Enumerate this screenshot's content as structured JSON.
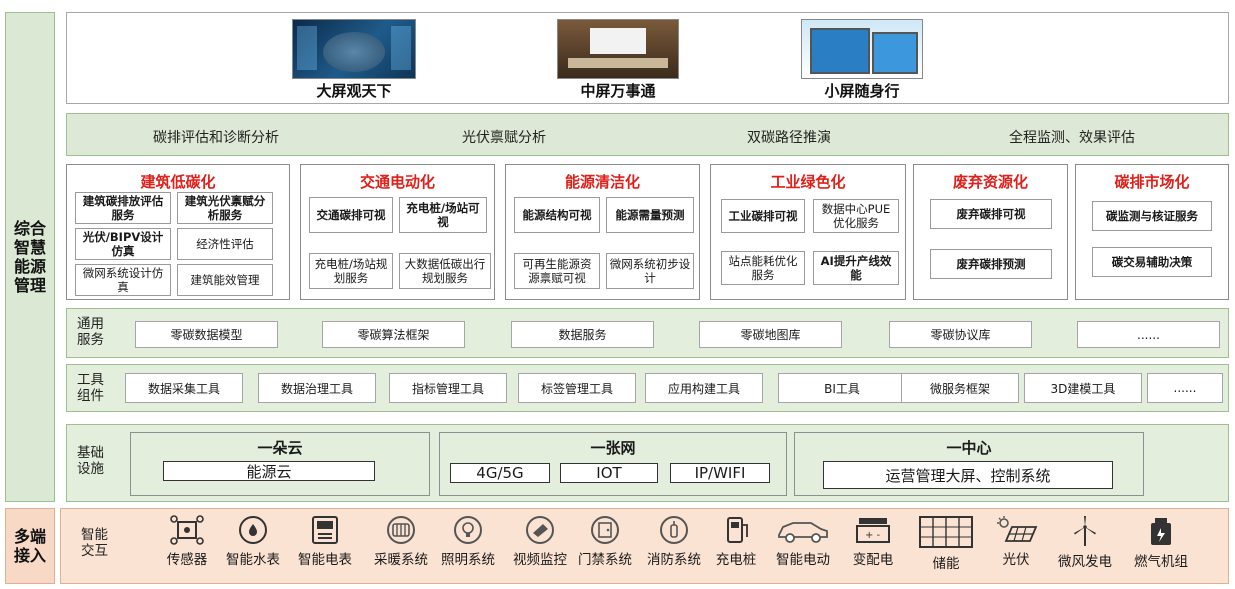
{
  "sidebar": {
    "top": "综合智慧能源管理",
    "bottom": "多端接入"
  },
  "screens": [
    {
      "label": "大屏观天下"
    },
    {
      "label": "中屏万事通"
    },
    {
      "label": "小屏随身行"
    }
  ],
  "analysis": [
    "碳排评估和诊断分析",
    "光伏禀赋分析",
    "双碳路径推演",
    "全程监测、效果评估"
  ],
  "categories": [
    {
      "title": "建筑低碳化",
      "items": [
        "建筑碳排放评估服务",
        "建筑光伏禀赋分析服务",
        "光伏/BIPV设计仿真",
        "经济性评估",
        "微网系统设计仿真",
        "建筑能效管理"
      ]
    },
    {
      "title": "交通电动化",
      "items": [
        "交通碳排可视",
        "充电桩/场站可视",
        "充电桩/场站规划服务",
        "大数据低碳出行规划服务"
      ]
    },
    {
      "title": "能源清洁化",
      "items": [
        "能源结构可视",
        "能源需量预测",
        "可再生能源资源禀赋可视",
        "微网系统初步设计"
      ]
    },
    {
      "title": "工业绿色化",
      "items": [
        "工业碳排可视",
        "数据中心PUE优化服务",
        "站点能耗优化服务",
        "AI提升产线效能"
      ]
    },
    {
      "title": "废弃资源化",
      "items": [
        "废弃碳排可视",
        "废弃碳排预测"
      ]
    },
    {
      "title": "碳排市场化",
      "items": [
        "碳监测与核证服务",
        "碳交易辅助决策"
      ]
    }
  ],
  "common_services": {
    "label": "通用服务",
    "items": [
      "零碳数据模型",
      "零碳算法框架",
      "数据服务",
      "零碳地图库",
      "零碳协议库",
      "......"
    ]
  },
  "tool_components": {
    "label": "工具组件",
    "items": [
      "数据采集工具",
      "数据治理工具",
      "指标管理工具",
      "标签管理工具",
      "应用构建工具",
      "BI工具",
      "微服务框架",
      "3D建模工具",
      "......"
    ]
  },
  "infrastructure": {
    "label": "基础设施",
    "groups": [
      {
        "title": "一朵云",
        "items": [
          "能源云"
        ]
      },
      {
        "title": "一张网",
        "items": [
          "4G/5G",
          "IOT",
          "IP/WIFI"
        ]
      },
      {
        "title": "一中心",
        "items": [
          "运营管理大屏、控制系统"
        ]
      }
    ]
  },
  "access": {
    "label": "智能交互",
    "devices": [
      {
        "label": "传感器",
        "icon": "sensor-icon"
      },
      {
        "label": "智能水表",
        "icon": "water-meter-icon"
      },
      {
        "label": "智能电表",
        "icon": "electric-meter-icon"
      },
      {
        "label": "采暖系统",
        "icon": "heating-icon"
      },
      {
        "label": "照明系统",
        "icon": "lighting-icon"
      },
      {
        "label": "视频监控",
        "icon": "camera-icon"
      },
      {
        "label": "门禁系统",
        "icon": "access-control-icon"
      },
      {
        "label": "消防系统",
        "icon": "fire-icon"
      },
      {
        "label": "充电桩",
        "icon": "charger-icon"
      },
      {
        "label": "智能电动",
        "icon": "ev-car-icon"
      },
      {
        "label": "变配电",
        "icon": "transformer-icon"
      },
      {
        "label": "储能",
        "icon": "storage-icon"
      },
      {
        "label": "光伏",
        "icon": "solar-icon"
      },
      {
        "label": "微风发电",
        "icon": "wind-turbine-icon"
      },
      {
        "label": "燃气机组",
        "icon": "gas-generator-icon"
      }
    ]
  }
}
